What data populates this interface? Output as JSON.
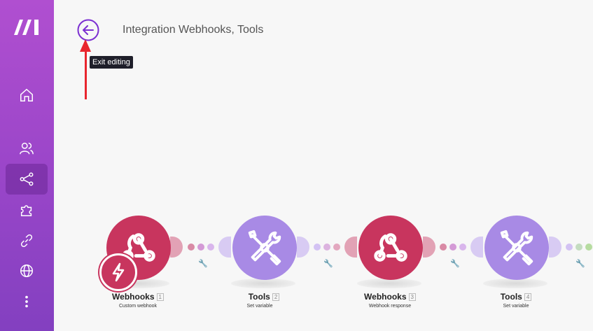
{
  "header": {
    "title": "Integration Webhooks, Tools",
    "back_tooltip": "Exit editing"
  },
  "sidebar": {
    "items": [
      {
        "name": "home-icon"
      },
      {
        "name": "team-icon"
      },
      {
        "name": "scenarios-icon",
        "active": true
      },
      {
        "name": "apps-puzzle-icon"
      },
      {
        "name": "connections-link-icon"
      },
      {
        "name": "globe-icon"
      },
      {
        "name": "more-vertical-icon"
      }
    ]
  },
  "modules": [
    {
      "label": "Webhooks",
      "number": "1",
      "sub": "Custom webhook",
      "kind": "webhook"
    },
    {
      "label": "Tools",
      "number": "2",
      "sub": "Set variable",
      "kind": "tools"
    },
    {
      "label": "Webhooks",
      "number": "3",
      "sub": "Webhook response",
      "kind": "webhook"
    },
    {
      "label": "Tools",
      "number": "4",
      "sub": "Set variable",
      "kind": "tools"
    }
  ],
  "colors": {
    "sidebar_top": "#b04fd0",
    "webhook": "#c8355e",
    "tools": "#a88ae5",
    "accent_back": "#7b2fd1",
    "annotation_arrow": "#e8262e"
  }
}
